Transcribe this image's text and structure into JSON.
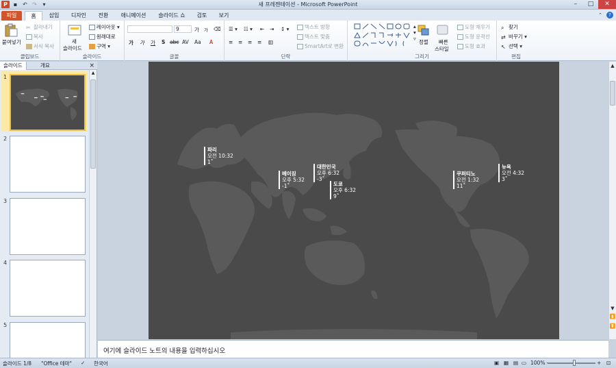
{
  "window": {
    "title": "새 프레젠테이션 - Microsoft PowerPoint",
    "app_icon": "P"
  },
  "tabs": [
    "파일",
    "홈",
    "삽입",
    "디자인",
    "전환",
    "애니메이션",
    "슬라이드 쇼",
    "검토",
    "보기"
  ],
  "ribbon": {
    "clipboard": {
      "paste": "붙여넣기",
      "cut": "잘라내기",
      "copy": "복사",
      "format_painter": "서식 복사",
      "label": "클립보드"
    },
    "slides": {
      "new_slide_1": "새",
      "new_slide_2": "슬라이드",
      "layout": "레이아웃",
      "reset": "원래대로",
      "section": "구역",
      "label": "슬라이드"
    },
    "font": {
      "size": "9",
      "bold": "가",
      "italic": "가",
      "underline": "가",
      "shadow": "S",
      "strike": "abc",
      "spacing": "AV",
      "case": "Aa",
      "grow": "가",
      "shrink": "가",
      "label": "글꼴"
    },
    "paragraph": {
      "text_direction": "텍스트 방향",
      "align_text": "텍스트 맞춤",
      "smartart": "SmartArt로 변환",
      "label": "단락"
    },
    "drawing": {
      "arrange": "정렬",
      "quick_styles_1": "빠른",
      "quick_styles_2": "스타일",
      "shape_fill": "도형 채우기",
      "shape_outline": "도형 윤곽선",
      "shape_effects": "도형 효과",
      "label": "그리기"
    },
    "editing": {
      "find": "찾기",
      "replace": "바꾸기",
      "select": "선택",
      "label": "편집"
    }
  },
  "panel": {
    "tab_slides": "슬라이드",
    "tab_outline": "개요",
    "close": "×",
    "numbers": [
      "1",
      "2",
      "3",
      "4",
      "5"
    ]
  },
  "cities": [
    {
      "name": "파리",
      "time": "오전 10:32",
      "temp": "1˚"
    },
    {
      "name": "베이징",
      "time": "오후 5:32",
      "temp": "-1˚"
    },
    {
      "name": "대한민국",
      "time": "오후 6:32",
      "temp": "-3˚"
    },
    {
      "name": "도쿄",
      "time": "오후 6:32",
      "temp": "9˚"
    },
    {
      "name": "쿠퍼티노",
      "time": "오전 1:32",
      "temp": "11˚"
    },
    {
      "name": "뉴욕",
      "time": "오전 4:32",
      "temp": "3˚"
    }
  ],
  "notes_placeholder": "여기에 슬라이드 노트의 내용을 입력하십시오",
  "status": {
    "slide": "슬라이드 1/8",
    "theme": "\"Office 테마\"",
    "language": "한국어",
    "zoom": "100%"
  }
}
